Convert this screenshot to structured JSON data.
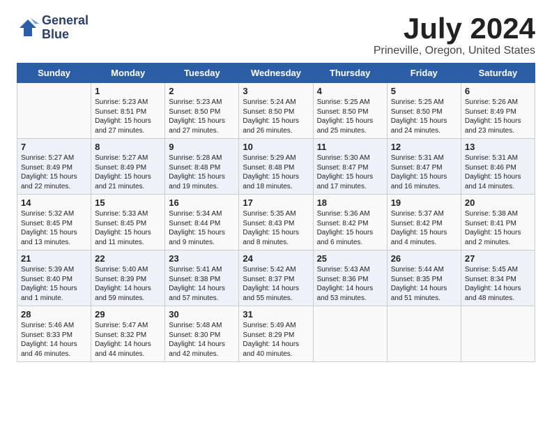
{
  "logo": {
    "line1": "General",
    "line2": "Blue"
  },
  "title": "July 2024",
  "location": "Prineville, Oregon, United States",
  "weekdays": [
    "Sunday",
    "Monday",
    "Tuesday",
    "Wednesday",
    "Thursday",
    "Friday",
    "Saturday"
  ],
  "weeks": [
    [
      {
        "day": "",
        "info": ""
      },
      {
        "day": "1",
        "info": "Sunrise: 5:23 AM\nSunset: 8:51 PM\nDaylight: 15 hours\nand 27 minutes."
      },
      {
        "day": "2",
        "info": "Sunrise: 5:23 AM\nSunset: 8:50 PM\nDaylight: 15 hours\nand 27 minutes."
      },
      {
        "day": "3",
        "info": "Sunrise: 5:24 AM\nSunset: 8:50 PM\nDaylight: 15 hours\nand 26 minutes."
      },
      {
        "day": "4",
        "info": "Sunrise: 5:25 AM\nSunset: 8:50 PM\nDaylight: 15 hours\nand 25 minutes."
      },
      {
        "day": "5",
        "info": "Sunrise: 5:25 AM\nSunset: 8:50 PM\nDaylight: 15 hours\nand 24 minutes."
      },
      {
        "day": "6",
        "info": "Sunrise: 5:26 AM\nSunset: 8:49 PM\nDaylight: 15 hours\nand 23 minutes."
      }
    ],
    [
      {
        "day": "7",
        "info": "Sunrise: 5:27 AM\nSunset: 8:49 PM\nDaylight: 15 hours\nand 22 minutes."
      },
      {
        "day": "8",
        "info": "Sunrise: 5:27 AM\nSunset: 8:49 PM\nDaylight: 15 hours\nand 21 minutes."
      },
      {
        "day": "9",
        "info": "Sunrise: 5:28 AM\nSunset: 8:48 PM\nDaylight: 15 hours\nand 19 minutes."
      },
      {
        "day": "10",
        "info": "Sunrise: 5:29 AM\nSunset: 8:48 PM\nDaylight: 15 hours\nand 18 minutes."
      },
      {
        "day": "11",
        "info": "Sunrise: 5:30 AM\nSunset: 8:47 PM\nDaylight: 15 hours\nand 17 minutes."
      },
      {
        "day": "12",
        "info": "Sunrise: 5:31 AM\nSunset: 8:47 PM\nDaylight: 15 hours\nand 16 minutes."
      },
      {
        "day": "13",
        "info": "Sunrise: 5:31 AM\nSunset: 8:46 PM\nDaylight: 15 hours\nand 14 minutes."
      }
    ],
    [
      {
        "day": "14",
        "info": "Sunrise: 5:32 AM\nSunset: 8:45 PM\nDaylight: 15 hours\nand 13 minutes."
      },
      {
        "day": "15",
        "info": "Sunrise: 5:33 AM\nSunset: 8:45 PM\nDaylight: 15 hours\nand 11 minutes."
      },
      {
        "day": "16",
        "info": "Sunrise: 5:34 AM\nSunset: 8:44 PM\nDaylight: 15 hours\nand 9 minutes."
      },
      {
        "day": "17",
        "info": "Sunrise: 5:35 AM\nSunset: 8:43 PM\nDaylight: 15 hours\nand 8 minutes."
      },
      {
        "day": "18",
        "info": "Sunrise: 5:36 AM\nSunset: 8:42 PM\nDaylight: 15 hours\nand 6 minutes."
      },
      {
        "day": "19",
        "info": "Sunrise: 5:37 AM\nSunset: 8:42 PM\nDaylight: 15 hours\nand 4 minutes."
      },
      {
        "day": "20",
        "info": "Sunrise: 5:38 AM\nSunset: 8:41 PM\nDaylight: 15 hours\nand 2 minutes."
      }
    ],
    [
      {
        "day": "21",
        "info": "Sunrise: 5:39 AM\nSunset: 8:40 PM\nDaylight: 15 hours\nand 1 minute."
      },
      {
        "day": "22",
        "info": "Sunrise: 5:40 AM\nSunset: 8:39 PM\nDaylight: 14 hours\nand 59 minutes."
      },
      {
        "day": "23",
        "info": "Sunrise: 5:41 AM\nSunset: 8:38 PM\nDaylight: 14 hours\nand 57 minutes."
      },
      {
        "day": "24",
        "info": "Sunrise: 5:42 AM\nSunset: 8:37 PM\nDaylight: 14 hours\nand 55 minutes."
      },
      {
        "day": "25",
        "info": "Sunrise: 5:43 AM\nSunset: 8:36 PM\nDaylight: 14 hours\nand 53 minutes."
      },
      {
        "day": "26",
        "info": "Sunrise: 5:44 AM\nSunset: 8:35 PM\nDaylight: 14 hours\nand 51 minutes."
      },
      {
        "day": "27",
        "info": "Sunrise: 5:45 AM\nSunset: 8:34 PM\nDaylight: 14 hours\nand 48 minutes."
      }
    ],
    [
      {
        "day": "28",
        "info": "Sunrise: 5:46 AM\nSunset: 8:33 PM\nDaylight: 14 hours\nand 46 minutes."
      },
      {
        "day": "29",
        "info": "Sunrise: 5:47 AM\nSunset: 8:32 PM\nDaylight: 14 hours\nand 44 minutes."
      },
      {
        "day": "30",
        "info": "Sunrise: 5:48 AM\nSunset: 8:30 PM\nDaylight: 14 hours\nand 42 minutes."
      },
      {
        "day": "31",
        "info": "Sunrise: 5:49 AM\nSunset: 8:29 PM\nDaylight: 14 hours\nand 40 minutes."
      },
      {
        "day": "",
        "info": ""
      },
      {
        "day": "",
        "info": ""
      },
      {
        "day": "",
        "info": ""
      }
    ]
  ]
}
